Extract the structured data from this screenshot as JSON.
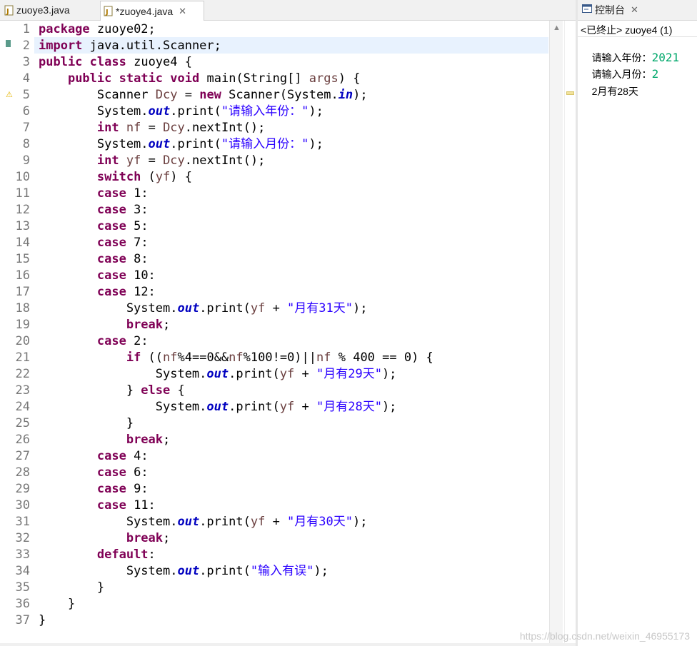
{
  "tabs": [
    {
      "label": "zuoye3.java",
      "active": false
    },
    {
      "label": "*zuoye4.java",
      "active": true
    }
  ],
  "console_tab": {
    "label": "控制台"
  },
  "icons": {
    "java_file": "java-file-icon",
    "close": "close-icon",
    "console": "console-icon",
    "warning": "warning-icon",
    "fold": "fold-minus-icon"
  },
  "editor": {
    "line_numbers": [
      "1",
      "2",
      "3",
      "4",
      "5",
      "6",
      "7",
      "8",
      "9",
      "10",
      "11",
      "12",
      "13",
      "14",
      "15",
      "16",
      "17",
      "18",
      "19",
      "20",
      "21",
      "22",
      "23",
      "24",
      "25",
      "26",
      "27",
      "28",
      "29",
      "30",
      "31",
      "32",
      "33",
      "34",
      "35",
      "36",
      "37"
    ],
    "current_line": 2,
    "lines": [
      [
        {
          "t": "package",
          "c": "kw"
        },
        {
          "t": " zuoye02;",
          "c": ""
        }
      ],
      [
        {
          "t": "import",
          "c": "kw"
        },
        {
          "t": " java.util.Scanner;",
          "c": ""
        }
      ],
      [
        {
          "t": "public",
          "c": "kw"
        },
        {
          "t": " ",
          "c": ""
        },
        {
          "t": "class",
          "c": "kw"
        },
        {
          "t": " zuoye4 {",
          "c": ""
        }
      ],
      [
        {
          "t": "    ",
          "c": ""
        },
        {
          "t": "public",
          "c": "kw"
        },
        {
          "t": " ",
          "c": ""
        },
        {
          "t": "static",
          "c": "kw"
        },
        {
          "t": " ",
          "c": ""
        },
        {
          "t": "void",
          "c": "kw"
        },
        {
          "t": " main(String[] ",
          "c": ""
        },
        {
          "t": "args",
          "c": "var"
        },
        {
          "t": ") {",
          "c": ""
        }
      ],
      [
        {
          "t": "        Scanner ",
          "c": ""
        },
        {
          "t": "Dcy",
          "c": "var"
        },
        {
          "t": " = ",
          "c": ""
        },
        {
          "t": "new",
          "c": "kw"
        },
        {
          "t": " Scanner(System.",
          "c": ""
        },
        {
          "t": "in",
          "c": "fld"
        },
        {
          "t": ");",
          "c": ""
        }
      ],
      [
        {
          "t": "        System.",
          "c": ""
        },
        {
          "t": "out",
          "c": "fld"
        },
        {
          "t": ".print(",
          "c": ""
        },
        {
          "t": "\"请输入年份：\"",
          "c": "str"
        },
        {
          "t": ");",
          "c": ""
        }
      ],
      [
        {
          "t": "        ",
          "c": ""
        },
        {
          "t": "int",
          "c": "kw"
        },
        {
          "t": " ",
          "c": ""
        },
        {
          "t": "nf",
          "c": "var"
        },
        {
          "t": " = ",
          "c": ""
        },
        {
          "t": "Dcy",
          "c": "var"
        },
        {
          "t": ".nextInt();",
          "c": ""
        }
      ],
      [
        {
          "t": "        System.",
          "c": ""
        },
        {
          "t": "out",
          "c": "fld"
        },
        {
          "t": ".print(",
          "c": ""
        },
        {
          "t": "\"请输入月份：\"",
          "c": "str"
        },
        {
          "t": ");",
          "c": ""
        }
      ],
      [
        {
          "t": "        ",
          "c": ""
        },
        {
          "t": "int",
          "c": "kw"
        },
        {
          "t": " ",
          "c": ""
        },
        {
          "t": "yf",
          "c": "var"
        },
        {
          "t": " = ",
          "c": ""
        },
        {
          "t": "Dcy",
          "c": "var"
        },
        {
          "t": ".nextInt();",
          "c": ""
        }
      ],
      [
        {
          "t": "        ",
          "c": ""
        },
        {
          "t": "switch",
          "c": "kw"
        },
        {
          "t": " (",
          "c": ""
        },
        {
          "t": "yf",
          "c": "var"
        },
        {
          "t": ") {",
          "c": ""
        }
      ],
      [
        {
          "t": "        ",
          "c": ""
        },
        {
          "t": "case",
          "c": "kw"
        },
        {
          "t": " 1:",
          "c": ""
        }
      ],
      [
        {
          "t": "        ",
          "c": ""
        },
        {
          "t": "case",
          "c": "kw"
        },
        {
          "t": " 3:",
          "c": ""
        }
      ],
      [
        {
          "t": "        ",
          "c": ""
        },
        {
          "t": "case",
          "c": "kw"
        },
        {
          "t": " 5:",
          "c": ""
        }
      ],
      [
        {
          "t": "        ",
          "c": ""
        },
        {
          "t": "case",
          "c": "kw"
        },
        {
          "t": " 7:",
          "c": ""
        }
      ],
      [
        {
          "t": "        ",
          "c": ""
        },
        {
          "t": "case",
          "c": "kw"
        },
        {
          "t": " 8:",
          "c": ""
        }
      ],
      [
        {
          "t": "        ",
          "c": ""
        },
        {
          "t": "case",
          "c": "kw"
        },
        {
          "t": " 10:",
          "c": ""
        }
      ],
      [
        {
          "t": "        ",
          "c": ""
        },
        {
          "t": "case",
          "c": "kw"
        },
        {
          "t": " 12:",
          "c": ""
        }
      ],
      [
        {
          "t": "            System.",
          "c": ""
        },
        {
          "t": "out",
          "c": "fld"
        },
        {
          "t": ".print(",
          "c": ""
        },
        {
          "t": "yf",
          "c": "var"
        },
        {
          "t": " + ",
          "c": ""
        },
        {
          "t": "\"月有31天\"",
          "c": "str"
        },
        {
          "t": ");",
          "c": ""
        }
      ],
      [
        {
          "t": "            ",
          "c": ""
        },
        {
          "t": "break",
          "c": "kw"
        },
        {
          "t": ";",
          "c": ""
        }
      ],
      [
        {
          "t": "        ",
          "c": ""
        },
        {
          "t": "case",
          "c": "kw"
        },
        {
          "t": " 2:",
          "c": ""
        }
      ],
      [
        {
          "t": "            ",
          "c": ""
        },
        {
          "t": "if",
          "c": "kw"
        },
        {
          "t": " ((",
          "c": ""
        },
        {
          "t": "nf",
          "c": "var"
        },
        {
          "t": "%4==0&&",
          "c": ""
        },
        {
          "t": "nf",
          "c": "var"
        },
        {
          "t": "%100!=0)||",
          "c": ""
        },
        {
          "t": "nf",
          "c": "var"
        },
        {
          "t": " % 400 == 0) {",
          "c": ""
        }
      ],
      [
        {
          "t": "                System.",
          "c": ""
        },
        {
          "t": "out",
          "c": "fld"
        },
        {
          "t": ".print(",
          "c": ""
        },
        {
          "t": "yf",
          "c": "var"
        },
        {
          "t": " + ",
          "c": ""
        },
        {
          "t": "\"月有29天\"",
          "c": "str"
        },
        {
          "t": ");",
          "c": ""
        }
      ],
      [
        {
          "t": "            } ",
          "c": ""
        },
        {
          "t": "else",
          "c": "kw"
        },
        {
          "t": " {",
          "c": ""
        }
      ],
      [
        {
          "t": "                System.",
          "c": ""
        },
        {
          "t": "out",
          "c": "fld"
        },
        {
          "t": ".print(",
          "c": ""
        },
        {
          "t": "yf",
          "c": "var"
        },
        {
          "t": " + ",
          "c": ""
        },
        {
          "t": "\"月有28天\"",
          "c": "str"
        },
        {
          "t": ");",
          "c": ""
        }
      ],
      [
        {
          "t": "            }",
          "c": ""
        }
      ],
      [
        {
          "t": "            ",
          "c": ""
        },
        {
          "t": "break",
          "c": "kw"
        },
        {
          "t": ";",
          "c": ""
        }
      ],
      [
        {
          "t": "        ",
          "c": ""
        },
        {
          "t": "case",
          "c": "kw"
        },
        {
          "t": " 4:",
          "c": ""
        }
      ],
      [
        {
          "t": "        ",
          "c": ""
        },
        {
          "t": "case",
          "c": "kw"
        },
        {
          "t": " 6:",
          "c": ""
        }
      ],
      [
        {
          "t": "        ",
          "c": ""
        },
        {
          "t": "case",
          "c": "kw"
        },
        {
          "t": " 9:",
          "c": ""
        }
      ],
      [
        {
          "t": "        ",
          "c": ""
        },
        {
          "t": "case",
          "c": "kw"
        },
        {
          "t": " 11:",
          "c": ""
        }
      ],
      [
        {
          "t": "            System.",
          "c": ""
        },
        {
          "t": "out",
          "c": "fld"
        },
        {
          "t": ".print(",
          "c": ""
        },
        {
          "t": "yf",
          "c": "var"
        },
        {
          "t": " + ",
          "c": ""
        },
        {
          "t": "\"月有30天\"",
          "c": "str"
        },
        {
          "t": ");",
          "c": ""
        }
      ],
      [
        {
          "t": "            ",
          "c": ""
        },
        {
          "t": "break",
          "c": "kw"
        },
        {
          "t": ";",
          "c": ""
        }
      ],
      [
        {
          "t": "        ",
          "c": ""
        },
        {
          "t": "default",
          "c": "kw"
        },
        {
          "t": ":",
          "c": ""
        }
      ],
      [
        {
          "t": "            System.",
          "c": ""
        },
        {
          "t": "out",
          "c": "fld"
        },
        {
          "t": ".print(",
          "c": ""
        },
        {
          "t": "\"输入有误\"",
          "c": "str"
        },
        {
          "t": ");",
          "c": ""
        }
      ],
      [
        {
          "t": "        }",
          "c": ""
        }
      ],
      [
        {
          "t": "    }",
          "c": ""
        }
      ],
      [
        {
          "t": "}",
          "c": ""
        }
      ]
    ]
  },
  "console": {
    "header": "<已终止> zuoye4 (1)",
    "lines": [
      {
        "prompt": "请输入年份：",
        "input": "2021"
      },
      {
        "prompt": "请输入月份：",
        "input": "2"
      },
      {
        "prompt": "2月有28天",
        "input": ""
      }
    ]
  },
  "watermark": "https://blog.csdn.net/weixin_46955173",
  "colors": {
    "keyword": "#7f0055",
    "string": "#2a00ff",
    "field": "#0000c0",
    "local_var": "#6a3e3e",
    "console_input": "#00a86b",
    "current_line": "#e8f2fe"
  }
}
